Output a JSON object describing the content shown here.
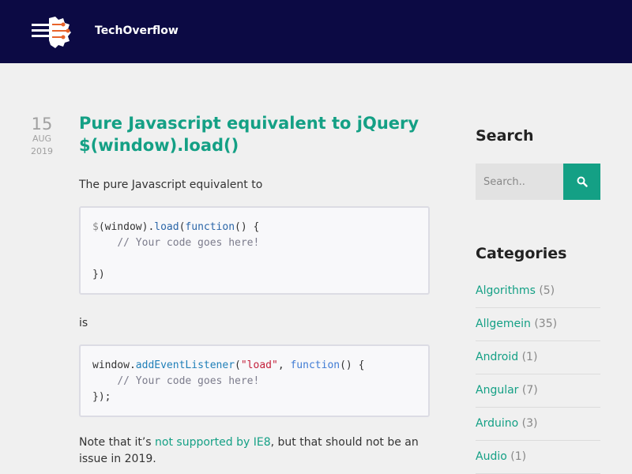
{
  "header": {
    "site_title": "TechOverflow"
  },
  "post": {
    "date": {
      "day": "15",
      "month": "AUG",
      "year": "2019"
    },
    "title": "Pure Javascript equivalent to jQuery $(window).load()",
    "intro": "The pure Javascript equivalent to",
    "connector": "is",
    "note": {
      "before": "Note that it’s ",
      "link": "not supported by IE8",
      "after": ", but that should not be an issue in 2019."
    }
  },
  "sidebar": {
    "search_title": "Search",
    "search_placeholder": "Search..",
    "categories_title": "Categories",
    "categories": [
      {
        "name": "Algorithms",
        "count": "(5)"
      },
      {
        "name": "Allgemein",
        "count": "(35)"
      },
      {
        "name": "Android",
        "count": "(1)"
      },
      {
        "name": "Angular",
        "count": "(7)"
      },
      {
        "name": "Arduino",
        "count": "(3)"
      },
      {
        "name": "Audio",
        "count": "(1)"
      }
    ]
  },
  "colors": {
    "header_bg": "#0c0a44",
    "accent": "#14a085",
    "page_bg": "#f0f0f0"
  }
}
